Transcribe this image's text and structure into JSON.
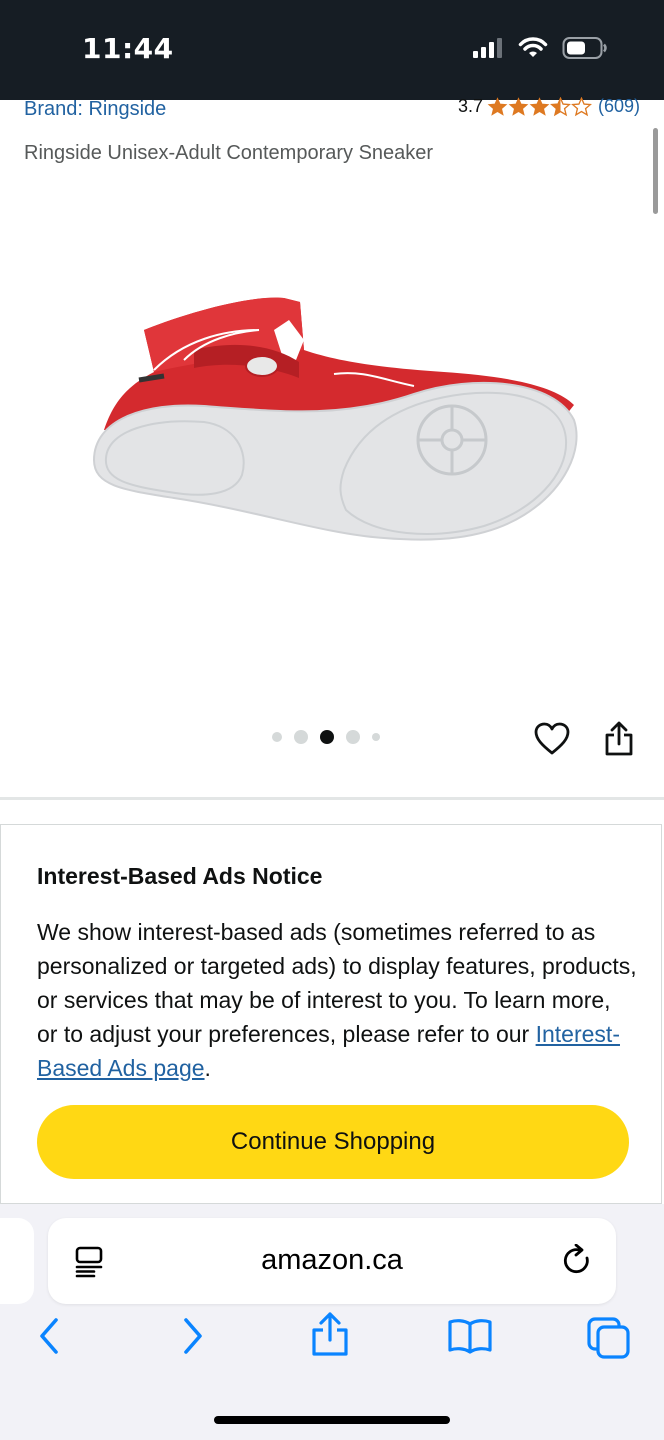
{
  "status_bar": {
    "time": "11:44"
  },
  "product": {
    "brand": "Brand: Ringside",
    "rating_value": "3.7",
    "rating_stars": 3.5,
    "rating_count": "(609)",
    "title": "Ringside Unisex-Adult Contemporary Sneaker"
  },
  "carousel": {
    "total_images": 5,
    "active_index": 2
  },
  "notice": {
    "title": "Interest-Based Ads Notice",
    "body": "We show interest-based ads (sometimes referred to as personalized or targeted ads) to display features, products, or services that may be of interest to you. To learn more, or to adjust your preferences, please refer to our ",
    "link_text": "Interest-Based Ads page",
    "body_end": ".",
    "button_label": "Continue Shopping"
  },
  "browser": {
    "url": "amazon.ca"
  },
  "colors": {
    "accent_link": "#2162a1",
    "button_yellow": "#ffd814",
    "star_orange": "#de7921",
    "ios_blue": "#0a84ff"
  }
}
